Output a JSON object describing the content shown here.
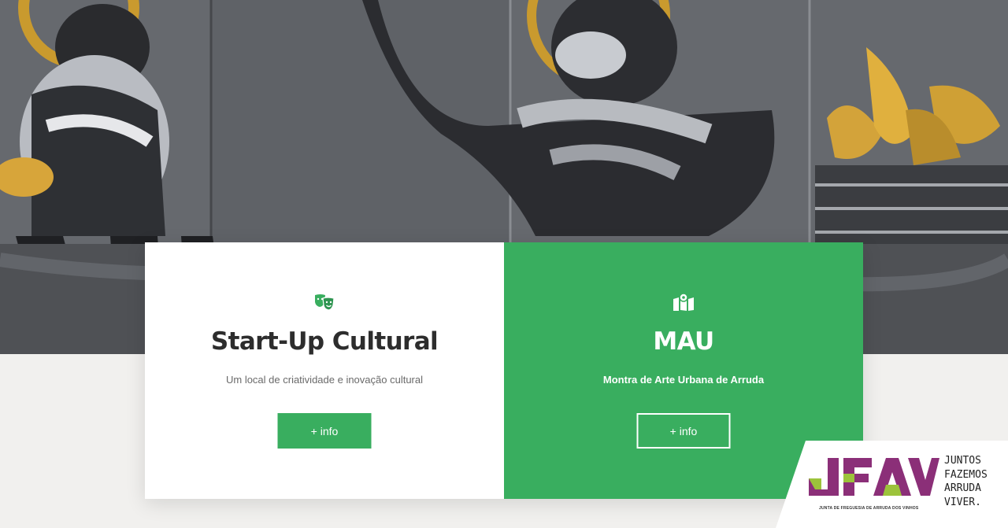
{
  "colors": {
    "accent_green": "#39ae5f",
    "card_white": "#ffffff",
    "title_dark": "#2d2d2d",
    "logo_purple": "#8b2f78",
    "logo_lime": "#9cc33b"
  },
  "cards": [
    {
      "icon": "theater-masks-icon",
      "title": "Start-Up Cultural",
      "subtitle": "Um local de criatividade e inovação cultural",
      "button_label": "+ info"
    },
    {
      "icon": "map-icon",
      "title": "MAU",
      "subtitle": "Montra de Arte Urbana de Arruda",
      "button_label": "+ info"
    }
  ],
  "logo": {
    "name": "JFAV",
    "caption": "JUNTA DE FREGUESIA DE ARRUDA DOS VINHOS",
    "tagline": [
      "JUNTOS",
      "FAZEMOS",
      "ARRUDA",
      "VIVER."
    ]
  }
}
